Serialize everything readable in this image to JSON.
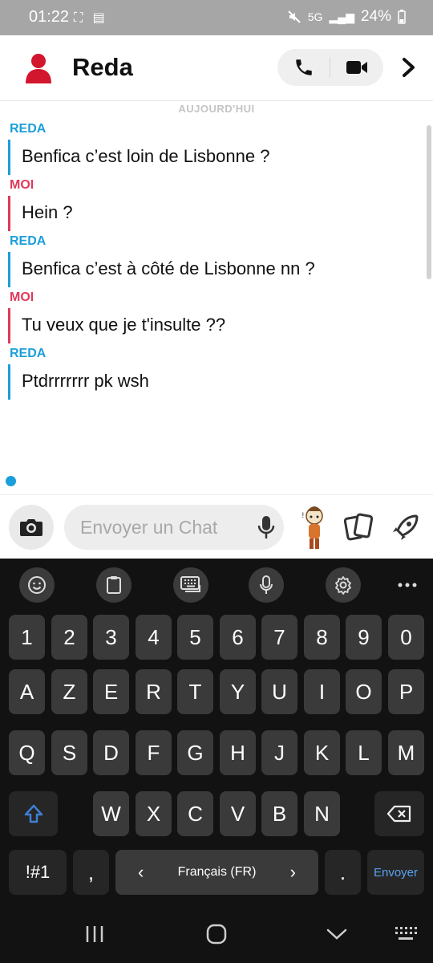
{
  "status_bar": {
    "time": "01:22",
    "left_icons": "⛶ ▤",
    "network": "5G",
    "signal": "▂▄▆",
    "battery": "24%"
  },
  "header": {
    "contact_name": "Reda",
    "icons": [
      "avatar-icon",
      "phone-icon",
      "video-icon",
      "chevron-right-icon"
    ]
  },
  "chat": {
    "day_label": "AUJOURD'HUI",
    "messages": [
      {
        "sender": "REDA",
        "text": "Benfica c’est loin de Lisbonne ?"
      },
      {
        "sender": "MOI",
        "text": "Hein ?"
      },
      {
        "sender": "REDA",
        "text": "Benfica c’est à côté de Lisbonne nn ?"
      },
      {
        "sender": "MOI",
        "text": "Tu veux que je t'insulte ??"
      },
      {
        "sender": "REDA",
        "text": "Ptdrrrrrrr pk wsh"
      }
    ]
  },
  "input": {
    "placeholder": "Envoyer un Chat",
    "value": ""
  },
  "keyboard": {
    "toolbar_icons": [
      "emoji-icon",
      "clipboard-icon",
      "keyboard-icon",
      "mic-icon",
      "settings-icon",
      "more-icon"
    ],
    "row_numbers": [
      "1",
      "2",
      "3",
      "4",
      "5",
      "6",
      "7",
      "8",
      "9",
      "0"
    ],
    "row1": [
      "A",
      "Z",
      "E",
      "R",
      "T",
      "Y",
      "U",
      "I",
      "O",
      "P"
    ],
    "row2": [
      "Q",
      "S",
      "D",
      "F",
      "G",
      "H",
      "J",
      "K",
      "L",
      "M"
    ],
    "row3": [
      "W",
      "X",
      "C",
      "V",
      "B",
      "N"
    ],
    "sym_key": "!#1",
    "comma_key": ",",
    "space_label": "Français (FR)",
    "space_left_arrow": "‹",
    "space_right_arrow": "›",
    "period_key": ".",
    "enter_label": "Envoyer"
  },
  "colors": {
    "reda": "#1b9fd8",
    "moi": "#e0395a",
    "keyboard_bg": "#121212",
    "key_bg": "#3a3a3a",
    "shift_accent": "#3f7fd6",
    "enter_text": "#5aa2f0"
  }
}
